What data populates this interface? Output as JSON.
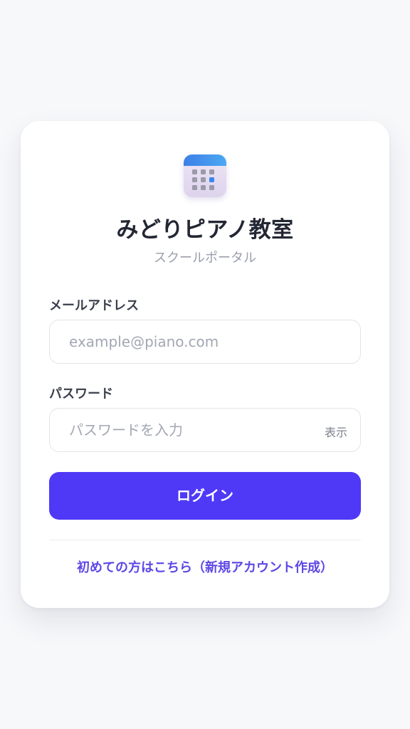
{
  "app": {
    "title": "みどりピアノ教室",
    "subtitle": "スクールポータル",
    "logo_icon": "calendar-icon",
    "accent_color": "#4f39f6"
  },
  "form": {
    "email_label": "メールアドレス",
    "email_placeholder": "example@piano.com",
    "email_value": "",
    "password_label": "パスワード",
    "password_placeholder": "パスワードを入力",
    "password_value": "",
    "show_password_label": "表示",
    "login_label": "ログイン"
  },
  "footer": {
    "register_link": "初めての方はこちら（新規アカウント作成）"
  }
}
